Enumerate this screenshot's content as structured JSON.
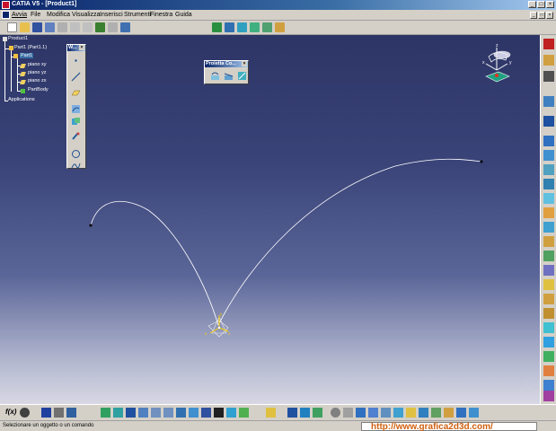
{
  "window": {
    "title": "CATIA V5 - [Product1]",
    "controls": [
      "_",
      "□",
      "×"
    ]
  },
  "menu": {
    "items": [
      "Avvia",
      "File",
      "Modifica",
      "Visualizza",
      "Inserisci",
      "Strumenti",
      "Finestra",
      "Guida"
    ],
    "doc_controls": [
      "_",
      "□",
      "×"
    ]
  },
  "tree": {
    "root": "Product1",
    "part_instance": "Part1 (Part1.1)",
    "part": "Part1",
    "planes": [
      "piano xy",
      "piano yz",
      "piano zx"
    ],
    "body": "PartBody",
    "applications": "Applications"
  },
  "wireframe_palette": {
    "title": "W...",
    "close": "×"
  },
  "projection_palette": {
    "title": "Proietta Co...",
    "close": "×"
  },
  "compass": {
    "x_label": "x",
    "y_label": "y",
    "z_label": "z"
  },
  "axis": {
    "x_label": "x",
    "y_label": "y",
    "z_label": "z"
  },
  "statusbar": {
    "message": "Selezionare un oggetto o un comando",
    "command_value": "http://www.grafica2d3d.com/"
  },
  "bottom_toolbar": {
    "fog_label": "f(x)"
  },
  "colors": {
    "viewport_top": "#2d3566",
    "viewport_bottom": "#d8d8e4",
    "curve": "#ffffff",
    "title_active": "#0a246a",
    "watermark": "#d06010"
  }
}
